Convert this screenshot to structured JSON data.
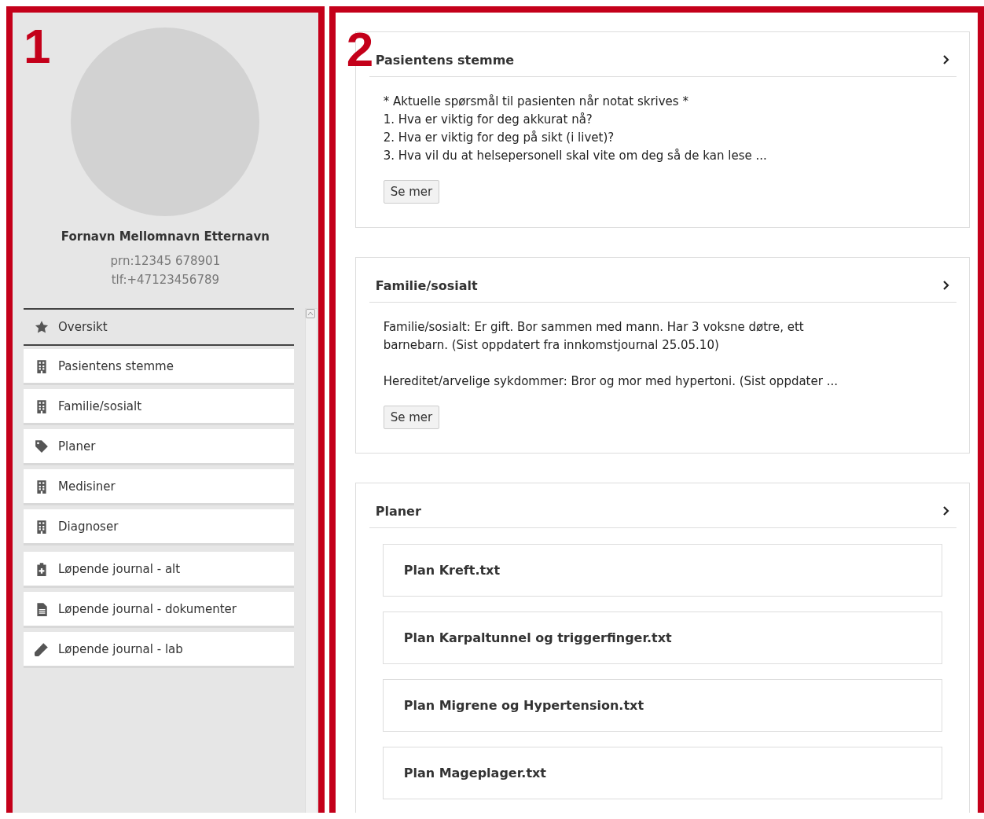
{
  "panel_labels": [
    "1",
    "2"
  ],
  "patient": {
    "name": "Fornavn Mellomnavn Etternavn",
    "prn": "prn:12345 678901",
    "phone": "tlf:+47123456789"
  },
  "nav": [
    {
      "label": "Oversikt",
      "kind": "star",
      "selected": true
    },
    {
      "label": "Pasientens stemme",
      "kind": "building",
      "selected": false
    },
    {
      "label": "Familie/sosialt",
      "kind": "building",
      "selected": false
    },
    {
      "label": "Planer",
      "kind": "tag",
      "selected": false
    },
    {
      "label": "Medisiner",
      "kind": "building",
      "selected": false
    },
    {
      "label": "Diagnoser",
      "kind": "building",
      "selected": false
    },
    {
      "label": "Løpende journal - alt",
      "kind": "clipboard",
      "selected": false
    },
    {
      "label": "Løpende journal - dokumenter",
      "kind": "file",
      "selected": false
    },
    {
      "label": "Løpende journal - lab",
      "kind": "tube",
      "selected": false
    }
  ],
  "sections": [
    {
      "title": "Pasientens stemme",
      "kind": "text",
      "paragraphs": [
        [
          "* Aktuelle spørsmål til pasienten når notat skrives *",
          "1. Hva er viktig for deg akkurat nå?",
          "2. Hva er viktig for deg på sikt (i livet)?",
          "3. Hva vil du at helsepersonell skal vite om deg så de kan lese  ..."
        ]
      ],
      "button": "Se mer"
    },
    {
      "title": "Familie/sosialt",
      "kind": "text",
      "paragraphs": [
        [
          "Familie/sosialt: Er gift. Bor sammen med mann. Har 3 voksne døtre, ett barnebarn. (Sist oppdatert fra innkomstjournal 25.05.10)"
        ],
        [
          "Hereditet/arvelige sykdommer: Bror og mor med hypertoni. (Sist oppdater ..."
        ]
      ],
      "button": "Se mer"
    },
    {
      "title": "Planer",
      "kind": "files",
      "files": [
        "Plan Kreft.txt",
        "Plan Karpaltunnel og triggerfinger.txt",
        "Plan Migrene og Hypertension.txt",
        "Plan Mageplager.txt"
      ]
    }
  ]
}
